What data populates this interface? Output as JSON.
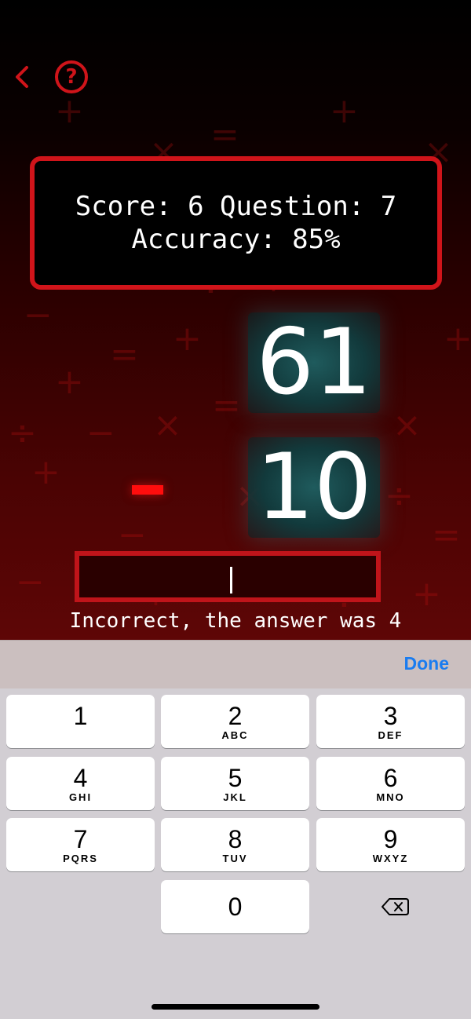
{
  "nav": {
    "back_icon": "chevron-left-icon",
    "help_icon": "question-circle-icon",
    "help_glyph": "?"
  },
  "scoreboard": {
    "line1": "Score: 6 Question: 7",
    "line2": "Accuracy: 85%"
  },
  "problem": {
    "first_number": "61",
    "second_number": "10",
    "operator": "minus"
  },
  "answer": {
    "value": ""
  },
  "feedback": "Incorrect, the answer was 4",
  "keyboard": {
    "done_label": "Done",
    "keys": [
      {
        "digit": "1",
        "letters": ""
      },
      {
        "digit": "2",
        "letters": "ABC"
      },
      {
        "digit": "3",
        "letters": "DEF"
      },
      {
        "digit": "4",
        "letters": "GHI"
      },
      {
        "digit": "5",
        "letters": "JKL"
      },
      {
        "digit": "6",
        "letters": "MNO"
      },
      {
        "digit": "7",
        "letters": "PQRS"
      },
      {
        "digit": "8",
        "letters": "TUV"
      },
      {
        "digit": "9",
        "letters": "WXYZ"
      },
      {
        "digit": "0",
        "letters": ""
      }
    ],
    "delete_icon": "backspace-icon"
  },
  "colors": {
    "accent_red": "#d0141a",
    "done_blue": "#1a7cf0",
    "number_panel": "#1f5b5d"
  }
}
